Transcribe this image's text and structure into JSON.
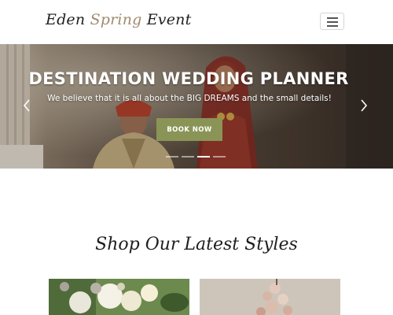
{
  "header": {
    "brand_part1": "Eden ",
    "brand_part2": "Spring",
    "brand_part3": " Event",
    "brand_accent_color": "#a08b6e",
    "menu_icon": "hamburger-menu-icon"
  },
  "hero": {
    "title": "DESTINATION WEDDING PLANNER",
    "subtitle": "We believe that it is all about the BIG DREAMS and the small details!",
    "button_label": "BOOK NOW",
    "button_color": "#8a9456",
    "prev_icon": "chevron-left-icon",
    "next_icon": "chevron-right-icon",
    "slide_count": 4,
    "active_slide": 3
  },
  "section": {
    "title": "Shop Our Latest Styles"
  },
  "products": [
    {
      "image": "white-flower-bouquet"
    },
    {
      "image": "pink-flower-arrangement"
    }
  ]
}
